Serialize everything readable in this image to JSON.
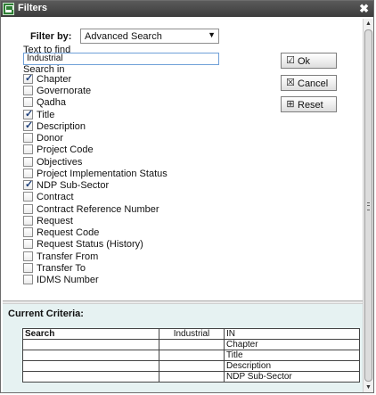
{
  "window": {
    "title": "Filters",
    "app_icon": "excel-icon",
    "close_icon": "close-icon"
  },
  "filter": {
    "label": "Filter by:",
    "selected": "Advanced Search"
  },
  "text_to_find": {
    "label": "Text to find",
    "value": "Industrial"
  },
  "search_in": {
    "label": "Search in",
    "items": [
      {
        "label": "Chapter",
        "checked": true
      },
      {
        "label": "Governorate",
        "checked": false
      },
      {
        "label": "Qadha",
        "checked": false
      },
      {
        "label": "Title",
        "checked": true
      },
      {
        "label": "Description",
        "checked": true
      },
      {
        "label": "Donor",
        "checked": false
      },
      {
        "label": "Project Code",
        "checked": false
      },
      {
        "label": "Objectives",
        "checked": false
      },
      {
        "label": "Project Implementation Status",
        "checked": false
      },
      {
        "label": "NDP Sub-Sector",
        "checked": true
      },
      {
        "label": "Contract",
        "checked": false
      },
      {
        "label": "Contract Reference Number",
        "checked": false
      },
      {
        "label": "Request",
        "checked": false
      },
      {
        "label": "Request Code",
        "checked": false
      },
      {
        "label": "Request Status (History)",
        "checked": false
      },
      {
        "label": "Transfer From",
        "checked": false
      },
      {
        "label": "Transfer To",
        "checked": false
      },
      {
        "label": "IDMS Number",
        "checked": false
      }
    ]
  },
  "buttons": [
    {
      "label": "Ok",
      "icon": "ok-icon"
    },
    {
      "label": "Cancel",
      "icon": "cancel-icon"
    },
    {
      "label": "Reset",
      "icon": "reset-icon"
    }
  ],
  "criteria": {
    "title": "Current Criteria:",
    "rows": [
      [
        "Search",
        "Industrial",
        "IN"
      ],
      [
        "",
        "",
        "Chapter"
      ],
      [
        "",
        "",
        "Title"
      ],
      [
        "",
        "",
        "Description"
      ],
      [
        "",
        "",
        "NDP Sub-Sector"
      ]
    ]
  }
}
